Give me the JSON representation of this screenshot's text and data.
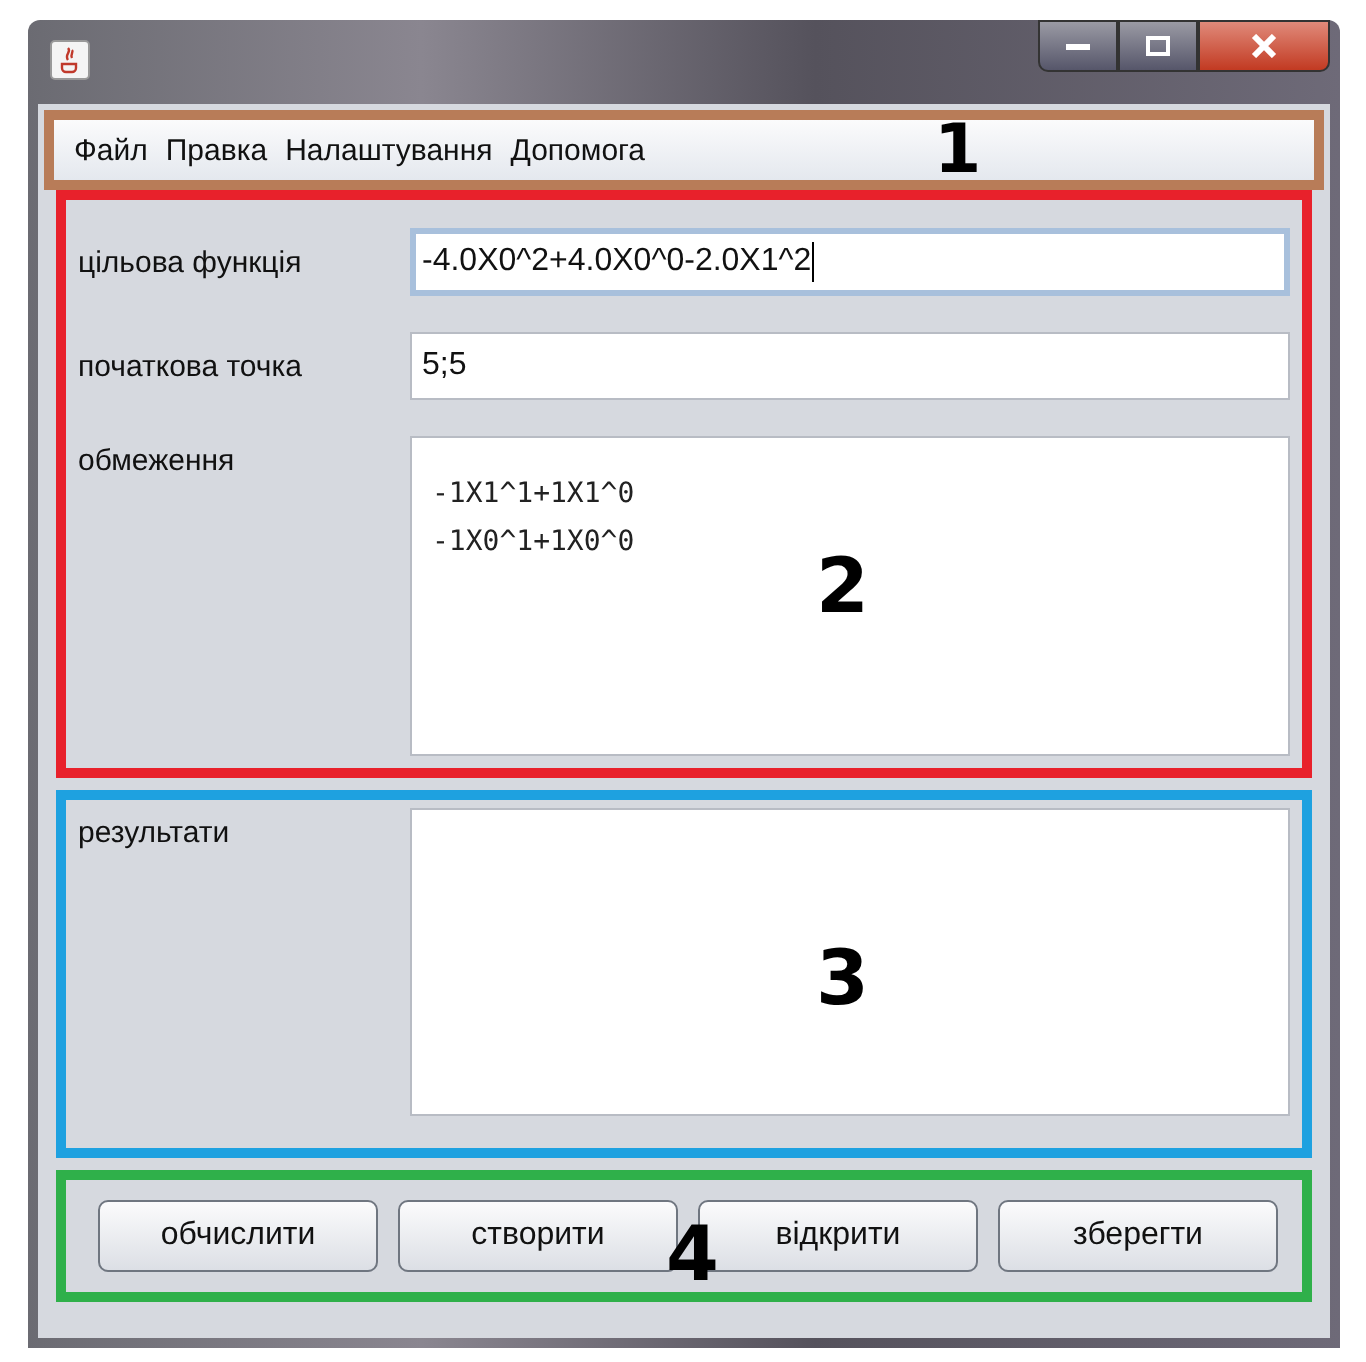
{
  "menu_bar": {
    "items": [
      "Файл",
      "Правка",
      "Налаштування",
      "Допомога"
    ],
    "callout": {
      "number": "1",
      "color": "#b87c58"
    }
  },
  "inputs": {
    "callout": {
      "number": "2",
      "color": "#e8212b"
    },
    "fields": [
      {
        "kind": "line",
        "label": "цільова функція",
        "value": "-4.0X0^2+4.0X0^0-2.0X1^2",
        "focused": true
      },
      {
        "kind": "line",
        "label": "початкова точка",
        "value": "5;5",
        "focused": false
      },
      {
        "kind": "area",
        "label": "обмеження",
        "lines": [
          "-1X1^1+1X1^0",
          "-1X0^1+1X0^0"
        ]
      }
    ]
  },
  "results": {
    "label": "результати",
    "callout": {
      "number": "3",
      "color": "#1ea1e0"
    }
  },
  "actions": {
    "callout": {
      "number": "4",
      "color": "#2fb04a"
    },
    "buttons": [
      "обчислити",
      "створити",
      "відкрити",
      "зберегти"
    ]
  }
}
